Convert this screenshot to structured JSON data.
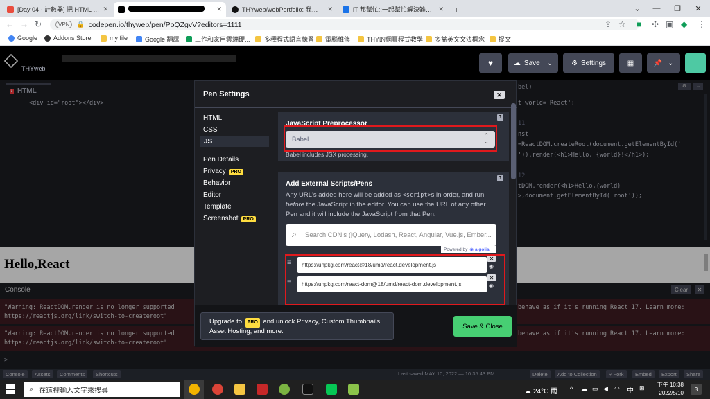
{
  "browser": {
    "tabs": [
      {
        "title": "[Day 04 - 計數器] 把 HTML 寫在",
        "active": false,
        "favicon_color": "#e94c3d"
      },
      {
        "title": "",
        "active": true,
        "favicon_color": "#000000"
      },
      {
        "title": "THYweb/webPortfolio: 我叫湯...",
        "active": false,
        "favicon_color": "#111111"
      },
      {
        "title": "iT 邦幫忙::一起幫忙解決難題，拯",
        "active": false,
        "favicon_color": "#1a73e8"
      }
    ],
    "new_tab": "+",
    "url": "codepen.io/thyweb/pen/PoQZgvV?editors=1111",
    "vpn_badge": "VPN",
    "bookmarks": [
      {
        "label": "Google",
        "color": "#4285f4"
      },
      {
        "label": "Addons Store",
        "color": "#333333"
      },
      {
        "label": "my file",
        "color": "#f4c542"
      },
      {
        "label": "Google 翻譯",
        "color": "#4285f4"
      },
      {
        "label": "工作和家用雲端硬...",
        "color": "#0f9d58"
      },
      {
        "label": "多種程式語言練習",
        "color": "#f4c542"
      },
      {
        "label": "電腦維修",
        "color": "#f4c542"
      },
      {
        "label": "THY的網頁程式教學",
        "color": "#f4c542"
      },
      {
        "label": "多益英文文法概念",
        "color": "#f4c542"
      },
      {
        "label": "提文",
        "color": "#f4c542"
      }
    ]
  },
  "codepen": {
    "user": "THYweb",
    "save_label": "Save",
    "settings_label": "Settings",
    "html_tab": "HTML",
    "html_code": "<div id=\"root\"></div>",
    "js_tab_fragment": "bel)",
    "js_code": [
      "t world='React';",
      "",
      "11",
      "nst",
      "=ReactDOM.createRoot(document.getElementById('",
      "')).render(<h1>Hello, {world}!</h1>);",
      "",
      "12",
      "tDOM.render(<h1>Hello,{world}",
      ">,document.getElementById('root'));"
    ],
    "preview_heading": "Hello,React",
    "console_title": "Console",
    "clear_label": "Clear",
    "warnings": [
      {
        "left": "\"Warning: ReactDOM.render is no longer supported",
        "right": "behave as if it's running React 17. Learn more:",
        "link": "https://reactjs.org/link/switch-to-createroot\""
      },
      {
        "left": "\"Warning: ReactDOM.render is no longer supported",
        "right": "behave as if it's running React 17. Learn more:",
        "link": "https://reactjs.org/link/switch-to-createroot\""
      }
    ],
    "prompt": ">",
    "bottom_left": [
      "Console",
      "Assets",
      "Comments",
      "Shortcuts"
    ],
    "last_saved": "Last saved MAY 10, 2022 — 10:35:43 PM",
    "bottom_right": [
      "Delete",
      "Add to Collection",
      "Fork",
      "Embed",
      "Export",
      "Share"
    ]
  },
  "modal": {
    "title": "Pen Settings",
    "close": "✕",
    "nav": [
      {
        "label": "HTML",
        "pro": false,
        "selected": false
      },
      {
        "label": "CSS",
        "pro": false,
        "selected": false
      },
      {
        "label": "JS",
        "pro": false,
        "selected": true
      },
      {
        "label": "Pen Details",
        "pro": false,
        "selected": false
      },
      {
        "label": "Privacy",
        "pro": true,
        "selected": false
      },
      {
        "label": "Behavior",
        "pro": false,
        "selected": false
      },
      {
        "label": "Editor",
        "pro": false,
        "selected": false
      },
      {
        "label": "Template",
        "pro": false,
        "selected": false
      },
      {
        "label": "Screenshot",
        "pro": true,
        "selected": false
      }
    ],
    "pro_badge": "PRO",
    "preprocessor_title": "JavaScript Preprocessor",
    "preprocessor_value": "Babel",
    "preprocessor_note": "Babel includes JSX processing.",
    "help_icon": "?",
    "external_title": "Add External Scripts/Pens",
    "external_desc_1": "Any URL's added here will be added as",
    "external_desc_code": "<script>",
    "external_desc_2": "s in order, and run",
    "external_desc_before": "before",
    "external_desc_3": "the JavaScript in the editor. You can use the URL of any other Pen and it will include the JavaScript from that Pen.",
    "search_placeholder": "Search CDNjs (jQuery, Lodash, React, Angular, Vue.js, Ember...",
    "powered_by": "Powered by",
    "algolia": "algolia",
    "scripts": [
      "https://unpkg.com/react@18/umd/react.development.js",
      "https://unpkg.com/react-dom@18/umd/react-dom.development.js"
    ],
    "upgrade_pre": "Upgrade to",
    "upgrade_post": "and unlock Privacy, Custom Thumbnails, Asset Hosting, and more.",
    "save_close": "Save & Close"
  },
  "taskbar": {
    "search_placeholder": "在這裡輸入文字來搜尋",
    "weather": "24°C 雨",
    "ime": "中",
    "time": "下午 10:38",
    "date": "2022/5/10",
    "notifications": "3"
  }
}
